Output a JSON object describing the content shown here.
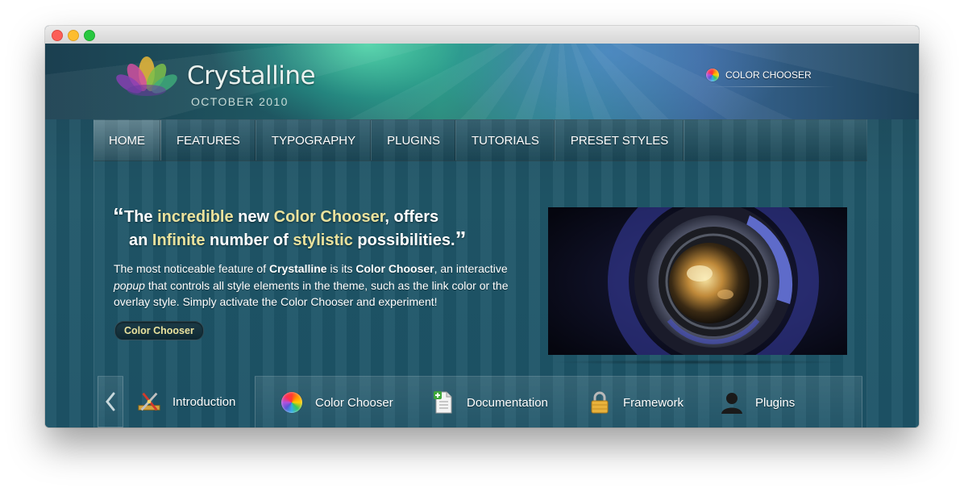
{
  "site": {
    "title": "Crystalline",
    "subtitle": "OCTOBER 2010",
    "color_chooser_label": "COLOR CHOOSER"
  },
  "nav": {
    "items": [
      {
        "label": "HOME",
        "active": true
      },
      {
        "label": "FEATURES",
        "active": false
      },
      {
        "label": "TYPOGRAPHY",
        "active": false
      },
      {
        "label": "PLUGINS",
        "active": false
      },
      {
        "label": "TUTORIALS",
        "active": false
      },
      {
        "label": "PRESET STYLES",
        "active": false
      }
    ]
  },
  "hero": {
    "quote_open": "“",
    "quote_part1": "The ",
    "quote_hl1": "incredible",
    "quote_part2": " new ",
    "quote_hl2": "Color Chooser",
    "quote_part3": ", offers",
    "quote_part4": "an ",
    "quote_hl3": "Infinite",
    "quote_part5": " number of ",
    "quote_hl4": "stylistic",
    "quote_part6": " possibilities.",
    "quote_close": "”",
    "desc_1": "The most noticeable feature of ",
    "desc_bold1": "Crystalline",
    "desc_2": " is its ",
    "desc_bold2": "Color Chooser",
    "desc_3": ", an interactive ",
    "desc_italic": "popup",
    "desc_4": " that controls all style elements in the theme, such as the link color or the overlay style. Simply activate the Color Chooser and experiment!",
    "button_label": "Color Chooser"
  },
  "slider": {
    "tabs": [
      {
        "label": "Introduction",
        "icon": "tools-icon"
      },
      {
        "label": "Color Chooser",
        "icon": "color-wheel-icon"
      },
      {
        "label": "Documentation",
        "icon": "document-add-icon"
      },
      {
        "label": "Framework",
        "icon": "lock-icon"
      },
      {
        "label": "Plugins",
        "icon": "user-icon"
      }
    ]
  },
  "colors": {
    "accent_text": "#eae29d",
    "nav_text": "#ffffff",
    "background": "#1d4d5f"
  }
}
